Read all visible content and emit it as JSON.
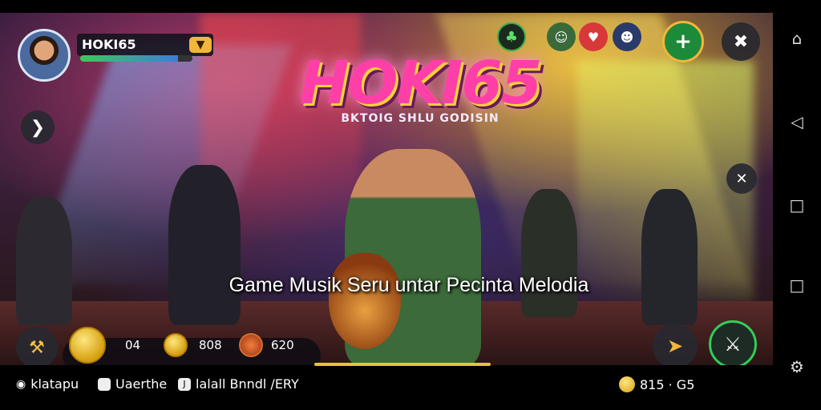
{
  "player": {
    "name": "HOKI65",
    "hp_fraction": 0.87
  },
  "logo": {
    "title": "HOKI65",
    "subtitle": "BKTOIG SHLU GODISIN"
  },
  "tagline": "Game Musik Seru untar Pecinta Melodia",
  "resources": {
    "a": "04",
    "b": "808",
    "c": "620"
  },
  "footer": {
    "item1": "klatapu",
    "item2": "Uaerthe",
    "item3": "lalall Bnndl /ERY",
    "balance": "815 · G5"
  },
  "icons": {
    "top_right": [
      "clover-icon",
      "face-icon",
      "heart-icon",
      "mask-icon",
      "plus-icon",
      "wrench-icon"
    ],
    "left": [
      "arrow-right-icon",
      "hammer-icon"
    ],
    "right": [
      "close-icon",
      "pick-icon",
      "sword-icon"
    ],
    "nav": [
      "home-icon",
      "back-icon",
      "recents-icon",
      "square-icon",
      "settings-icon"
    ]
  },
  "colors": {
    "accent": "#2fcf57",
    "gold": "#f2b63a",
    "logo_pink": "#ff3fa8"
  }
}
